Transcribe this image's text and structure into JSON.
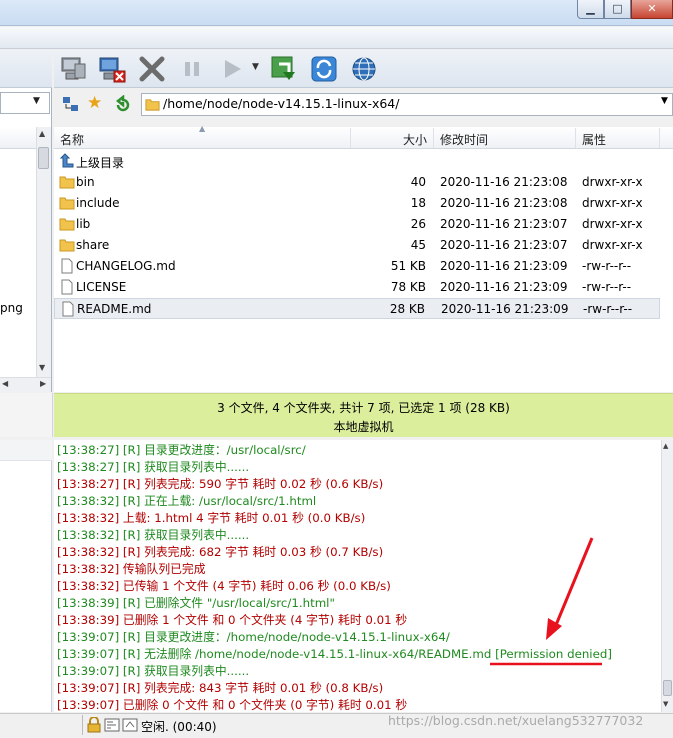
{
  "window": {
    "min_label": "▁",
    "max_label": "□",
    "close_label": "✕"
  },
  "toolbar": {
    "buttons": [
      "connect-icon",
      "disconnect-icon",
      "cancel-icon",
      "pause-icon",
      "play-icon",
      "sync-download-icon",
      "refresh-icon",
      "globe-icon"
    ]
  },
  "address": {
    "path": "/home/node/node-v14.15.1-linux-x64/"
  },
  "left_pane": {
    "visible_text": "png"
  },
  "list": {
    "headers": {
      "name": "名称",
      "size": "大小",
      "date": "修改时间",
      "attr": "属性"
    },
    "rows": [
      {
        "name": "上级目录",
        "size": "",
        "date": "",
        "attr": "",
        "icon": "parent-dir-icon"
      },
      {
        "name": "bin",
        "size": "40",
        "date": "2020-11-16 21:23:08",
        "attr": "drwxr-xr-x",
        "icon": "folder-icon"
      },
      {
        "name": "include",
        "size": "18",
        "date": "2020-11-16 21:23:08",
        "attr": "drwxr-xr-x",
        "icon": "folder-icon"
      },
      {
        "name": "lib",
        "size": "26",
        "date": "2020-11-16 21:23:07",
        "attr": "drwxr-xr-x",
        "icon": "folder-icon"
      },
      {
        "name": "share",
        "size": "45",
        "date": "2020-11-16 21:23:07",
        "attr": "drwxr-xr-x",
        "icon": "folder-icon"
      },
      {
        "name": "CHANGELOG.md",
        "size": "51 KB",
        "date": "2020-11-16 21:23:09",
        "attr": "-rw-r--r--",
        "icon": "file-icon"
      },
      {
        "name": "LICENSE",
        "size": "78 KB",
        "date": "2020-11-16 21:23:09",
        "attr": "-rw-r--r--",
        "icon": "file-icon"
      },
      {
        "name": "README.md",
        "size": "28 KB",
        "date": "2020-11-16 21:23:09",
        "attr": "-rw-r--r--",
        "icon": "file-icon",
        "selected": true
      }
    ]
  },
  "status": {
    "summary": "3 个文件, 4 个文件夹, 共计 7 项, 已选定 1 项 (28 KB)",
    "host": "本地虚拟机"
  },
  "log": [
    {
      "text": "[13:38:27] [R] 目录更改进度：/usr/local/src/",
      "color": "green"
    },
    {
      "text": "[13:38:27] [R] 获取目录列表中......",
      "color": "green"
    },
    {
      "text": "[13:38:27] [R] 列表完成: 590 字节 耗时 0.02 秒 (0.6 KB/s)",
      "color": "red"
    },
    {
      "text": "[13:38:32] [R] 正在上载: /usr/local/src/1.html",
      "color": "green"
    },
    {
      "text": "[13:38:32] 上载: 1.html 4 字节 耗时 0.01 秒 (0.0 KB/s)",
      "color": "red"
    },
    {
      "text": "[13:38:32] [R] 获取目录列表中......",
      "color": "green"
    },
    {
      "text": "[13:38:32] [R] 列表完成: 682 字节 耗时 0.03 秒 (0.7 KB/s)",
      "color": "red"
    },
    {
      "text": "[13:38:32] 传输队列已完成",
      "color": "red"
    },
    {
      "text": "[13:38:32] 已传输 1 个文件 (4 字节) 耗时 0.06 秒 (0.0 KB/s)",
      "color": "red"
    },
    {
      "text": "[13:38:39] [R] 已删除文件 \"/usr/local/src/1.html\"",
      "color": "green"
    },
    {
      "text": "[13:38:39] 已删除 1 个文件 和 0 个文件夹 (4 字节) 耗时 0.01 秒",
      "color": "red"
    },
    {
      "text": "[13:39:07] [R] 目录更改进度：/home/node/node-v14.15.1-linux-x64/",
      "color": "green"
    },
    {
      "text": "[13:39:07] [R] 无法删除 /home/node/node-v14.15.1-linux-x64/README.md [Permission denied]",
      "color": "green"
    },
    {
      "text": "[13:39:07] [R] 获取目录列表中......",
      "color": "green"
    },
    {
      "text": "[13:39:07] [R] 列表完成: 843 字节 耗时 0.01 秒 (0.8 KB/s)",
      "color": "red"
    },
    {
      "text": "[13:39:07] 已删除 0 个文件 和 0 个文件夹 (0 字节) 耗时 0.01 秒",
      "color": "red"
    }
  ],
  "bottom": {
    "status_text": "空闲. (00:40)",
    "watermark": "https://blog.csdn.net/xuelang532777032"
  },
  "colors": {
    "log_green": "#1f8a1f",
    "log_red": "#b30000",
    "status_bg": "#dbee9c",
    "annotation": "#e8121e"
  }
}
